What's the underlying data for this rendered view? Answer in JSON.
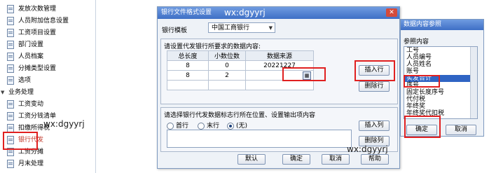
{
  "nav": {
    "items": [
      {
        "label": "发放次数管理",
        "type": "child"
      },
      {
        "label": "人员附加信息设置",
        "type": "child"
      },
      {
        "label": "工资项目设置",
        "type": "child"
      },
      {
        "label": "部门设置",
        "type": "child"
      },
      {
        "label": "人员档案",
        "type": "child"
      },
      {
        "label": "分摊类型设置",
        "type": "child"
      },
      {
        "label": "选项",
        "type": "child"
      },
      {
        "label": "业务处理",
        "type": "group"
      },
      {
        "label": "工资变动",
        "type": "child"
      },
      {
        "label": "工资分钱清单",
        "type": "child"
      },
      {
        "label": "扣缴所得税",
        "type": "child"
      },
      {
        "label": "银行代发",
        "type": "child"
      },
      {
        "label": "工资分摊",
        "type": "child"
      },
      {
        "label": "月末处理",
        "type": "child"
      }
    ]
  },
  "watermarks": [
    "wx:dgyyrj",
    "wx:dgyyrj",
    "wx:dgyyrj"
  ],
  "dialog": {
    "title": "银行文件格式设置",
    "bank_template_label": "银行模板",
    "bank_template_value": "中国工商银行",
    "section1_label": "请设置代发银行所要求的数据内容:",
    "grid_headers": [
      "总长度",
      "小数位数",
      "数据来源"
    ],
    "grid_rows": [
      [
        "8",
        "0",
        "20221227"
      ],
      [
        "8",
        "2",
        ""
      ]
    ],
    "insert_row": "插入行",
    "delete_row": "删除行",
    "section2_label": "请选择银行代发数据标志行所在位置、设置输出项内容",
    "radio_first": "首行",
    "radio_last": "末行",
    "radio_none": "(无)",
    "insert_col": "插入列",
    "delete_col": "删除列",
    "btn_default": "默认",
    "btn_ok": "确定",
    "btn_cancel": "取消",
    "btn_help": "帮助"
  },
  "panel": {
    "title": "数据内容参照",
    "ref_label": "参照内容",
    "items": [
      "工号",
      "人员编号",
      "人员姓名",
      "账号",
      "实发合计",
      "序号",
      "固定长度序号",
      "代付税",
      "年终奖",
      "年终奖代扣税"
    ],
    "selected_index": 4,
    "btn_ok": "确定",
    "btn_cancel": "取消"
  }
}
